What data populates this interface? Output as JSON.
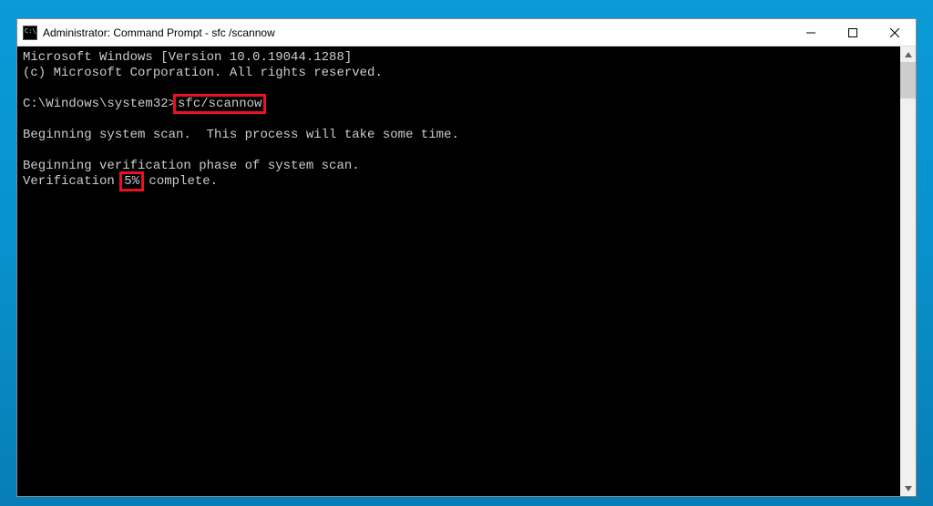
{
  "titlebar": {
    "title": "Administrator: Command Prompt - sfc /scannow"
  },
  "terminal": {
    "line_version": "Microsoft Windows [Version 10.0.19044.1288]",
    "line_copyright": "(c) Microsoft Corporation. All rights reserved.",
    "blank1": "",
    "prompt_prefix": "C:\\Windows\\system32>",
    "command": "sfc/scannow",
    "blank2": "",
    "line_begin": "Beginning system scan.  This process will take some time.",
    "blank3": "",
    "line_phase": "Beginning verification phase of system scan.",
    "verif_prefix": "Verification ",
    "percent": "5%",
    "verif_suffix": " complete."
  },
  "highlight_color": "#e81123"
}
